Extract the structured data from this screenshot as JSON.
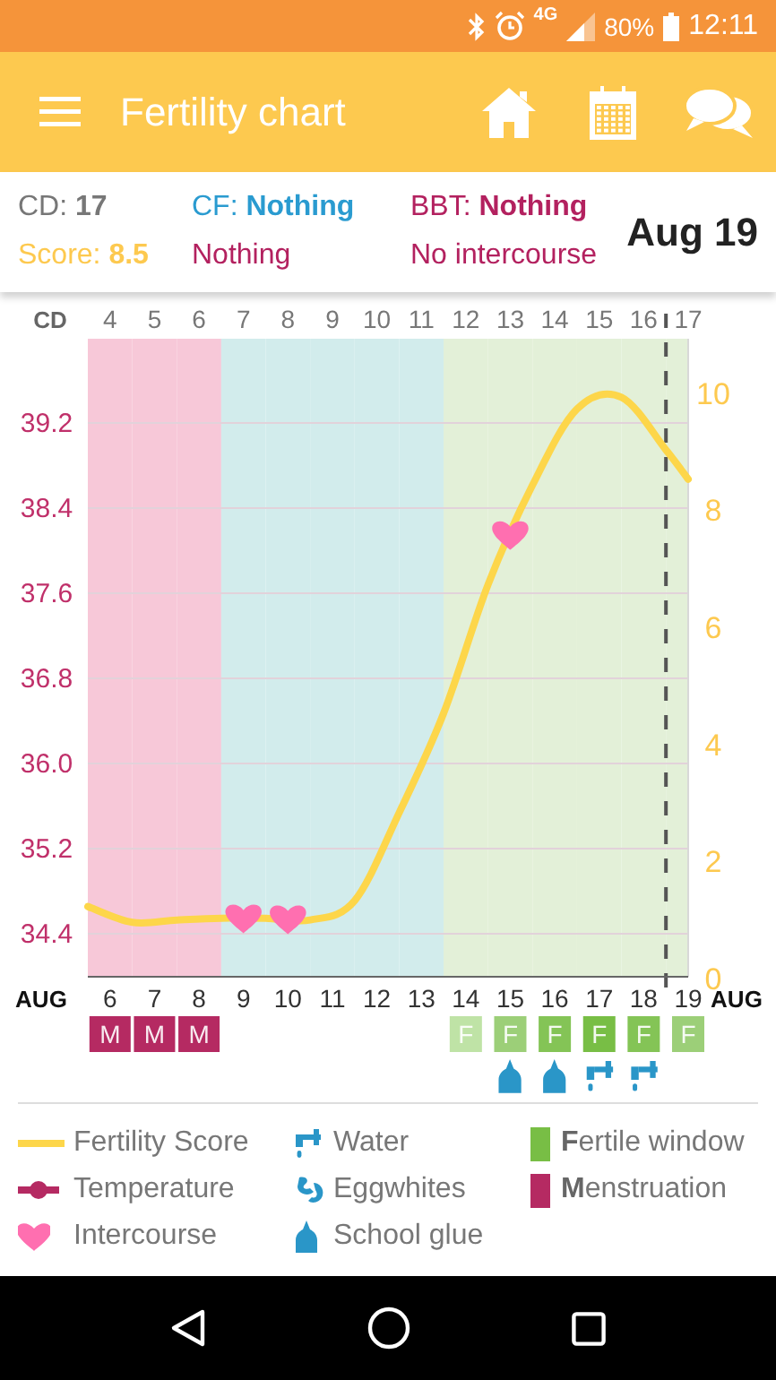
{
  "status_bar": {
    "network": "4G",
    "battery": "80%",
    "time": "12:11"
  },
  "app_bar": {
    "title": "Fertility chart"
  },
  "summary": {
    "cycle_day": "CD: **17**",
    "score": "Score: **8.5**",
    "cf": "CF: **Nothing**",
    "cf_note": "Nothing",
    "bbt": "BBT: **Nothing**",
    "intercourse": "No intercourse",
    "date": "Aug 19"
  },
  "chart": {
    "cd_label": "CD",
    "month_left": "AUG",
    "month_right": "AUG",
    "temperature_ticks": [
      "39.2",
      "38.4",
      "37.6",
      "36.8",
      "36.0",
      "35.2",
      "34.4"
    ],
    "days": [
      {
        "date": "6",
        "color": "#f7c8d8",
        "intercourse": false,
        "badge": {
          "kind": "menstruation",
          "text": "M",
          "color": "#b52a62"
        }
      },
      {
        "date": "7",
        "color": "#f7c8d8",
        "intercourse": false,
        "badge": {
          "kind": "menstruation",
          "text": "M",
          "color": "#b52a62"
        }
      },
      {
        "date": "8",
        "color": "#f7c8d8",
        "intercourse": false,
        "badge": {
          "kind": "menstruation",
          "text": "M",
          "color": "#b52a62"
        }
      },
      {
        "date": "9",
        "color": "#d2ecec",
        "intercourse": true
      },
      {
        "date": "10",
        "color": "#d2ecec",
        "intercourse": true
      },
      {
        "date": "11",
        "color": "#d2ecec",
        "intercourse": false
      },
      {
        "date": "12",
        "color": "#d2ecec",
        "intercourse": false
      },
      {
        "date": "13",
        "color": "#d2ecec",
        "intercourse": false
      },
      {
        "date": "14",
        "color": "#e3f0d8",
        "intercourse": false,
        "badge": {
          "kind": "fertile",
          "text": "F",
          "color": "#bfe3a6"
        }
      },
      {
        "date": "15",
        "color": "#e3f0d8",
        "intercourse": true,
        "badge": {
          "kind": "fertile",
          "text": "F",
          "color": "#9ccf78"
        },
        "fluid": {
          "kind": "school_glue"
        }
      },
      {
        "date": "16",
        "color": "#e3f0d8",
        "intercourse": false,
        "badge": {
          "kind": "fertile",
          "text": "F",
          "color": "#84c456"
        },
        "fluid": {
          "kind": "school_glue"
        }
      },
      {
        "date": "17",
        "color": "#e3f0d8",
        "intercourse": false,
        "badge": {
          "kind": "fertile",
          "text": "F",
          "color": "#78be45"
        },
        "fluid": {
          "kind": "water"
        }
      },
      {
        "date": "18",
        "color": "#e3f0d8",
        "intercourse": false,
        "badge": {
          "kind": "fertile",
          "text": "F",
          "color": "#84c456"
        },
        "fluid": {
          "kind": "water"
        }
      },
      {
        "date": "19",
        "color": "#e3f0d8",
        "intercourse": false,
        "badge": {
          "kind": "fertile",
          "text": "F",
          "color": "#9ccf78"
        }
      }
    ],
    "chart_data": {
      "type": "line",
      "x": [
        3.5,
        4.5,
        5.5,
        6.5,
        7.5,
        8.5,
        9.5,
        10.5,
        11.5,
        12.5,
        13.5,
        14.5,
        15.5,
        16.5,
        17
      ],
      "series": [
        {
          "color": "#fdd64a",
          "values": [
            1.2,
            0.93,
            0.97,
            1.0,
            1.0,
            0.97,
            1.3,
            2.8,
            4.5,
            6.7,
            8.4,
            9.7,
            9.9,
            9.0,
            8.5
          ]
        }
      ],
      "xlim": [
        3.5,
        17
      ],
      "ylim": [
        0,
        10.9
      ],
      "xticks": [
        4,
        5,
        6,
        7,
        8,
        9,
        10,
        11,
        12,
        13,
        14,
        15,
        16,
        17
      ],
      "yticks": [
        0,
        2,
        4,
        6,
        8,
        10
      ]
    },
    "today_line": true
  },
  "legend": [
    {
      "kind": "score-line",
      "label": "Fertility Score"
    },
    {
      "kind": "water",
      "label": "Water"
    },
    {
      "kind": "fertile",
      "label": "**F**ertile window"
    },
    {
      "kind": "temperature",
      "label": "Temperature"
    },
    {
      "kind": "eggwhites",
      "label": "Eggwhites"
    },
    {
      "kind": "menstruation",
      "label": "**M**enstruation"
    },
    {
      "kind": "intercourse",
      "label": "Intercourse"
    },
    {
      "kind": "school_glue",
      "label": "School glue"
    }
  ]
}
